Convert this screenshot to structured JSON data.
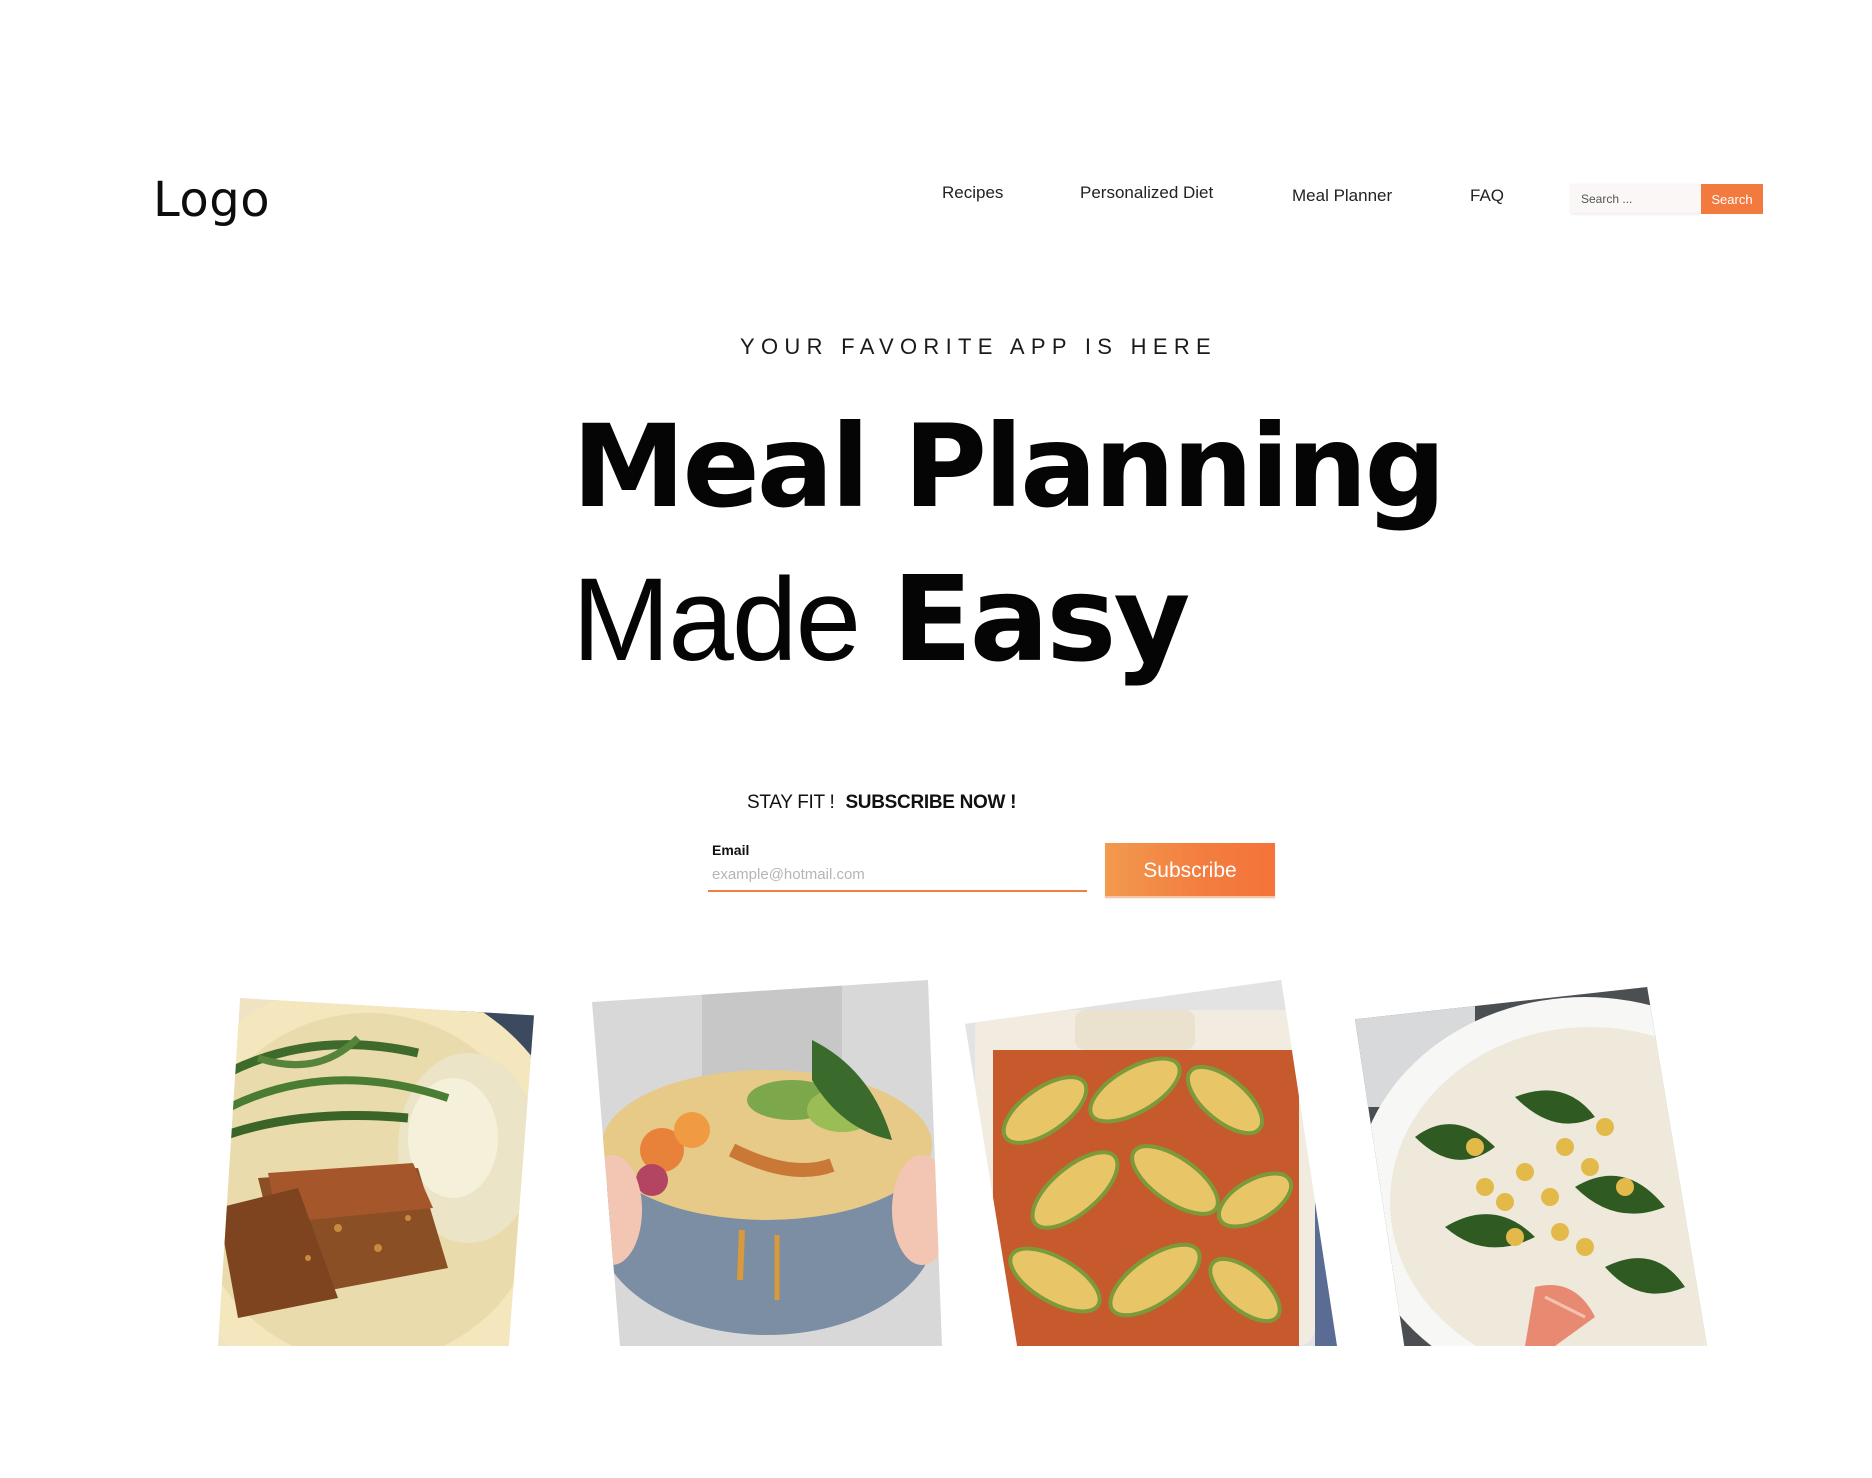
{
  "header": {
    "logo_text": "Logo",
    "nav": {
      "recipes": "Recipes",
      "personalized_diet": "Personalized Diet",
      "meal_planner": "Meal Planner",
      "faq": "FAQ"
    },
    "search": {
      "placeholder": "Search ...",
      "button_label": "Search"
    }
  },
  "hero": {
    "eyebrow": "YOUR FAVORITE APP IS HERE",
    "headline_line1": "Meal Planning",
    "headline_line2_light": "Made",
    "headline_line2_bold": "Easy"
  },
  "subscribe": {
    "tagline_light": "STAY FIT !",
    "tagline_bold": "SUBSCRIBE NOW !",
    "email_label": "Email",
    "email_placeholder": "example@hotmail.com",
    "button_label": "Subscribe"
  },
  "gallery": {
    "items": [
      {
        "icon": "meatloaf-plate-image"
      },
      {
        "icon": "grain-bowl-image"
      },
      {
        "icon": "zucchini-lasagna-image"
      },
      {
        "icon": "chickpea-spinach-salmon-image"
      }
    ]
  },
  "colors": {
    "accent": "#f37a3e",
    "text": "#111111",
    "background": "#ffffff"
  }
}
